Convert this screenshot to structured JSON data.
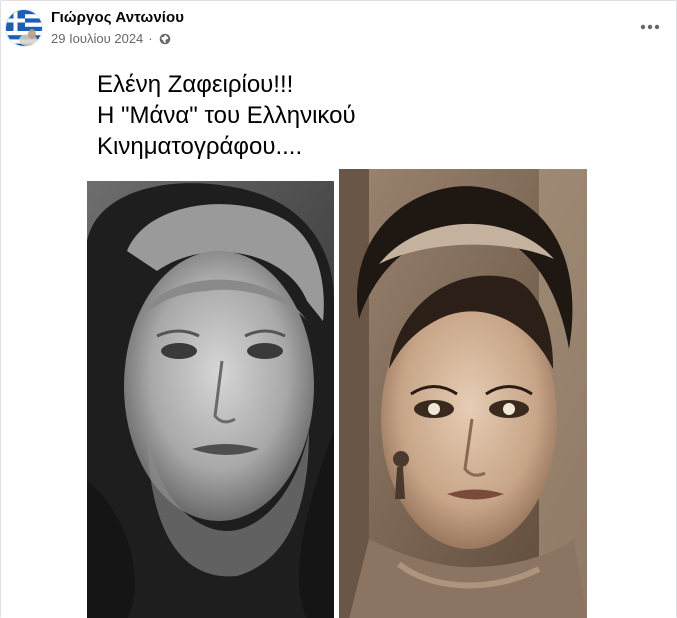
{
  "post": {
    "author": "Γιώργος Αντωνίου",
    "date": "29 Ιουλίου 2024",
    "separator": "·",
    "privacy_icon": "globe-icon",
    "more_icon": "more-options-icon",
    "avatar_icon": "greek-flag-avatar"
  },
  "image": {
    "caption_lines": [
      "Ελένη Ζαφειρίου!!!",
      "Η \"Μάνα\" του Ελληνικού",
      "Κινηματογράφου...."
    ]
  },
  "colors": {
    "meta_text": "#65676b",
    "border": "#dddfe2",
    "flag_blue": "#1c5eb4"
  }
}
